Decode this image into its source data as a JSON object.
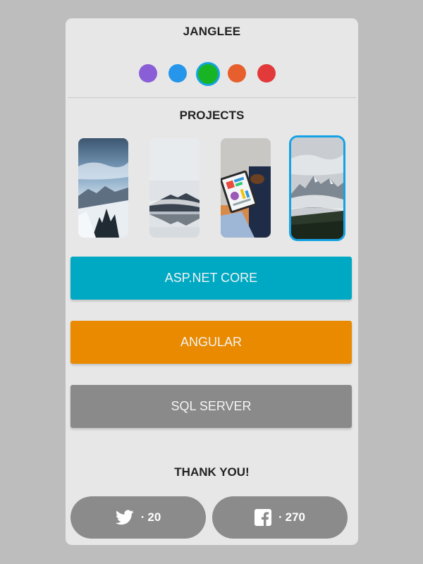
{
  "app": {
    "title": "JANGLEE"
  },
  "theme": {
    "swatches": [
      {
        "name": "purple",
        "color": "#8a5ed6",
        "selected": false
      },
      {
        "name": "blue",
        "color": "#2596ea",
        "selected": false
      },
      {
        "name": "green",
        "color": "#17b424",
        "selected": true
      },
      {
        "name": "orange",
        "color": "#e65f2c",
        "selected": false
      },
      {
        "name": "red",
        "color": "#e2393a",
        "selected": false
      }
    ]
  },
  "projects": {
    "heading": "PROJECTS",
    "thumbnails": [
      {
        "name": "snowy-mountain-forest",
        "selected": false
      },
      {
        "name": "misty-lake-reflection",
        "selected": false
      },
      {
        "name": "tablet-charts",
        "selected": false
      },
      {
        "name": "cloudy-mountain-peaks",
        "selected": true
      }
    ]
  },
  "technologies": [
    {
      "label": "ASP.NET CORE",
      "color": "#00a9c3"
    },
    {
      "label": "ANGULAR",
      "color": "#e98a00"
    },
    {
      "label": "SQL SERVER",
      "color": "#8a8a8a"
    }
  ],
  "footer": {
    "thanks": "THANK YOU!",
    "twitter": {
      "icon": "twitter-icon",
      "prefix": "·",
      "count": "20"
    },
    "facebook": {
      "icon": "facebook-icon",
      "prefix": "·",
      "count": "270"
    }
  }
}
